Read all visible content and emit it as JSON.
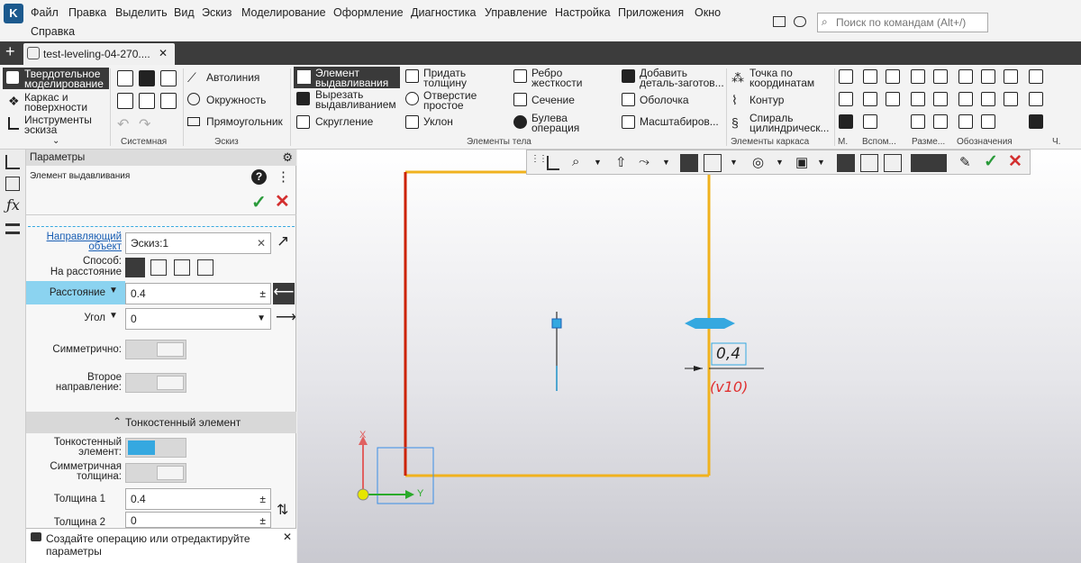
{
  "menu": [
    "Файл",
    "Правка",
    "Выделить",
    "Вид",
    "Эскиз",
    "Моделирование",
    "Оформление",
    "Диагностика",
    "Управление",
    "Настройка",
    "Приложения",
    "Окно",
    "Справка"
  ],
  "search": {
    "placeholder": "Поиск по командам (Alt+/)"
  },
  "tab": {
    "title": "test-leveling-04-270....",
    "close": "✕",
    "add": "+"
  },
  "ribbon": {
    "modes": [
      "Твердотельное моделирование",
      "Каркас и поверхности",
      "Инструменты эскиза"
    ],
    "sketch": [
      "Автолиния",
      "Окружность",
      "Прямоугольник"
    ],
    "body1": [
      "Элемент выдавливания",
      "Вырезать выдавливанием",
      "Скругление"
    ],
    "body2": [
      "Придать толщину",
      "Отверстие простое",
      "Уклон"
    ],
    "body3": [
      "Ребро жесткости",
      "Сечение",
      "Булева операция"
    ],
    "body4": [
      "Добавить деталь-заготов...",
      "Оболочка",
      "Масштабиров..."
    ],
    "frame": [
      "Точка по координатам",
      "Контур",
      "Спираль цилиндрическ..."
    ],
    "groups": [
      "Системная",
      "Эскиз",
      "Элементы тела",
      "Элементы каркаса",
      "М.",
      "Вспом...",
      "Разме...",
      "Обозначения",
      "Ч."
    ]
  },
  "panel": {
    "title": "Параметры",
    "subtitle": "Элемент выдавливания",
    "guide_label": "Направляющий объект",
    "guide_value": "Эскиз:1",
    "method_label": "Способ:",
    "method_value": "На расстояние",
    "distance_label": "Расстояние",
    "distance_value": "0.4",
    "angle_label": "Угол",
    "angle_value": "0",
    "symmetric_label": "Симметрично:",
    "second_dir_label": "Второе направление:",
    "thin_section": "Тонкостенный элемент",
    "thin_label": "Тонкостенный элемент:",
    "sym_thick_label": "Симметричная толщина:",
    "thick1_label": "Толщина 1",
    "thick1_value": "0.4",
    "thick2_label": "Толщина 2",
    "thick2_value": "0"
  },
  "hint": "Создайте операцию или отредактируйте параметры",
  "viewport": {
    "dim_value": "0,4",
    "dim_var": "(v10)",
    "axis_x": "X",
    "axis_y": "Y"
  },
  "colors": {
    "accent": "#35a8e0",
    "ok": "#2a9a3a",
    "cancel": "#d32f2f",
    "sketch_red": "#cc2200",
    "sketch_yellow": "#f0b21e"
  }
}
